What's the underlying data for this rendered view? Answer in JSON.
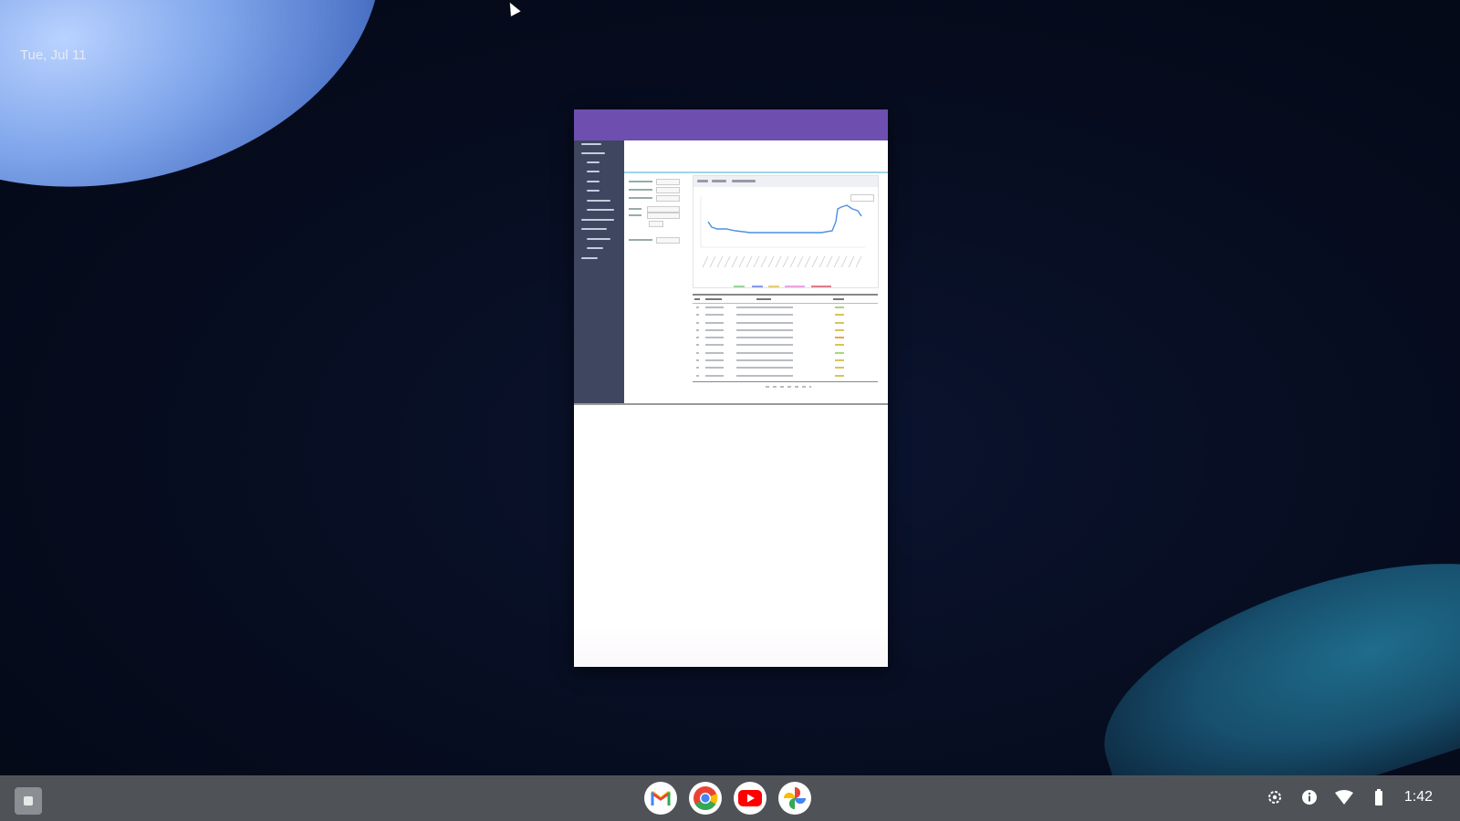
{
  "desktop": {
    "date": "Tue, Jul 11"
  },
  "shelf": {
    "apps": [
      {
        "name": "Gmail",
        "icon": "gmail-icon"
      },
      {
        "name": "Chrome",
        "icon": "chrome-icon"
      },
      {
        "name": "YouTube",
        "icon": "youtube-icon"
      },
      {
        "name": "Photos",
        "icon": "photos-icon"
      }
    ],
    "tray": {
      "icons": [
        "settings-icon",
        "info-icon",
        "wifi-icon",
        "battery-icon"
      ],
      "time": "1:42"
    }
  },
  "colors": {
    "window_header": "#6e4fb0",
    "sidebar": "#3f4660",
    "shelf": "#4f5358",
    "chart_line": "#4a90e2"
  }
}
